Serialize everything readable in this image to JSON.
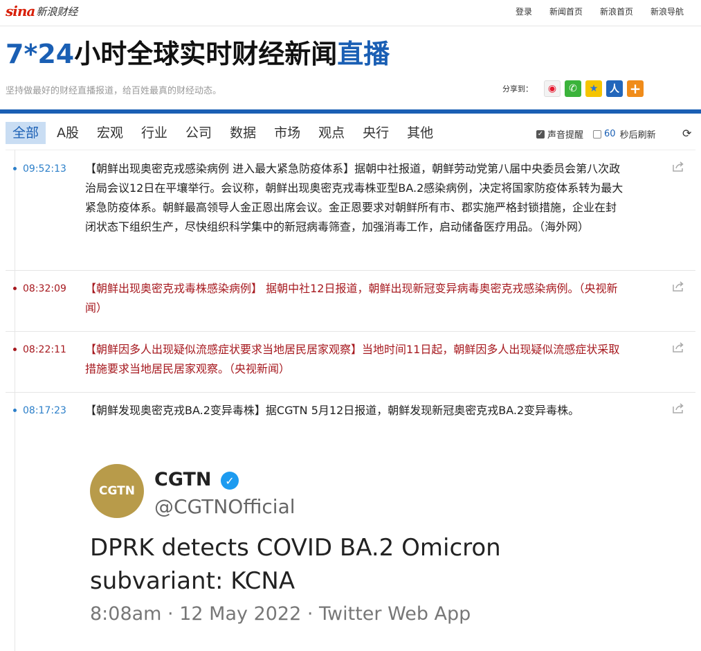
{
  "brand": {
    "sina": "sina",
    "name": "新浪财经"
  },
  "toplinks": [
    "登录",
    "新闻首页",
    "新浪首页",
    "新浪导航"
  ],
  "header": {
    "title_blue1": "7*24",
    "title_black": "小时全球实时财经新闻",
    "title_blue2": "直播",
    "subtitle": "坚持做最好的财经直播报道，给百姓最真的财经动态。",
    "share_label": "分享到："
  },
  "tabs": [
    "全部",
    "A股",
    "宏观",
    "行业",
    "公司",
    "数据",
    "市场",
    "观点",
    "央行",
    "其他"
  ],
  "options": {
    "sound_label": "声音提醒",
    "refresh_seconds": "60",
    "refresh_label": "秒后刷新"
  },
  "news": [
    {
      "time": "09:52:13",
      "text": "【朝鲜出现奥密克戎感染病例 进入最大紧急防疫体系】据朝中社报道，朝鲜劳动党第八届中央委员会第八次政治局会议12日在平壤举行。会议称，朝鲜出现奥密克戎毒株亚型BA.2感染病例，决定将国家防疫体系转为最大紧急防疫体系。朝鲜最高领导人金正恩出席会议。金正恩要求对朝鲜所有市、郡实施严格封锁措施，企业在封闭状态下组织生产，尽快组织科学集中的新冠病毒筛查，加强消毒工作，启动储备医疗用品。（海外网）"
    },
    {
      "time": "08:32:09",
      "text": "【朝鲜出现奥密克戎毒株感染病例】 据朝中社12日报道，朝鲜出现新冠变异病毒奥密克戎感染病例。（央视新闻）"
    },
    {
      "time": "08:22:11",
      "text": "【朝鲜因多人出现疑似流感症状要求当地居民居家观察】当地时间11日起，朝鲜因多人出现疑似流感症状采取措施要求当地居民居家观察。（央视新闻）"
    },
    {
      "time": "08:17:23",
      "text": "【朝鲜发现奥密克戎BA.2变异毒株】据CGTN 5月12日报道，朝鲜发现新冠奥密克戎BA.2变异毒株。"
    }
  ],
  "tweet": {
    "avatar_text": "CGTN",
    "name": "CGTN",
    "handle": "@CGTNOfficial",
    "text": "DPRK detects COVID BA.2 Omicron subvariant: KCNA",
    "meta": "8:08am · 12 May 2022 · Twitter Web App"
  },
  "colors": {
    "accent": "#1a5fb4",
    "alert": "#a6181e",
    "time_blue": "#2c7fc9"
  }
}
